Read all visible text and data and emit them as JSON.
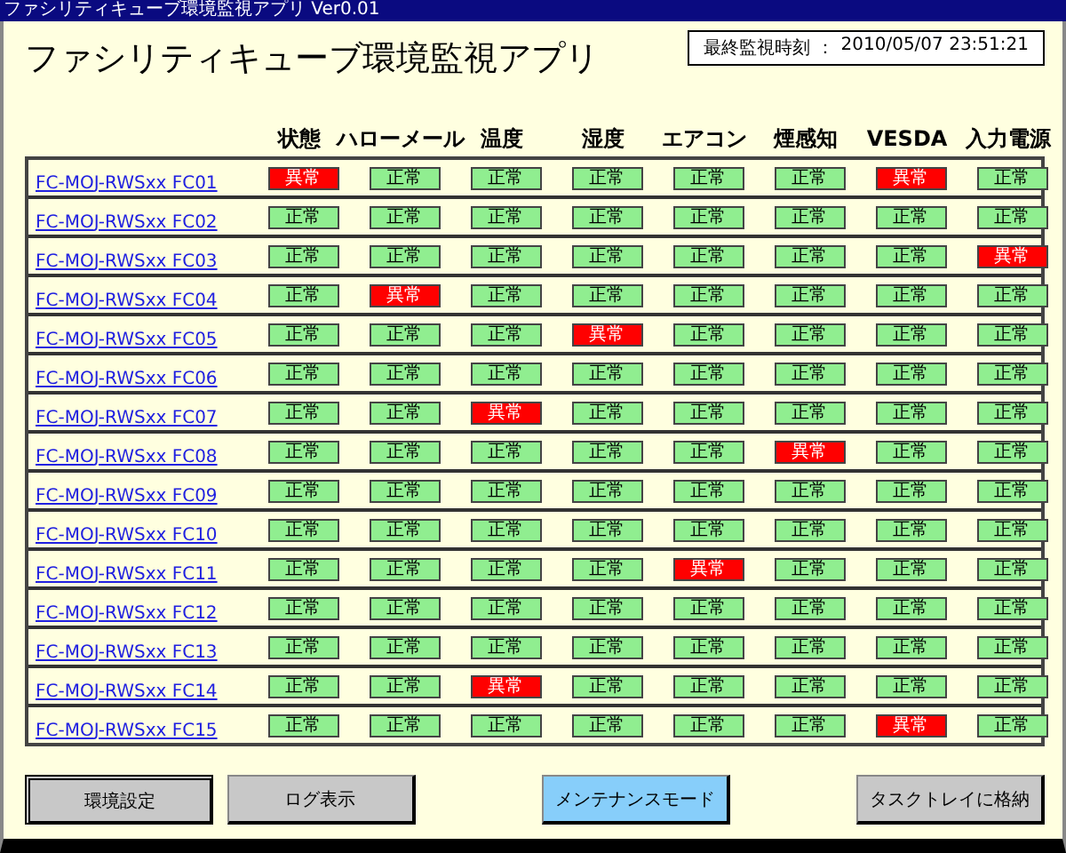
{
  "window": {
    "title": "ファシリティキューブ環境監視アプリ Ver0.01"
  },
  "app_title": "ファシリティキューブ環境監視アプリ",
  "last_check": {
    "label": "最終監視時刻 ：",
    "value": "2010/05/07 23:51:21"
  },
  "columns": [
    "状態",
    "ハローメール",
    "温度",
    "湿度",
    "エアコン",
    "煙感知",
    "VESDA",
    "入力電源"
  ],
  "rows": [
    {
      "name": "FC-MOJ-RWSxx FC01",
      "cells": [
        {
          "text": "異常",
          "alarm": true
        },
        {
          "text": "正常",
          "alarm": false
        },
        {
          "text": "正常",
          "alarm": false
        },
        {
          "text": "正常",
          "alarm": false
        },
        {
          "text": "正常",
          "alarm": false
        },
        {
          "text": "正常",
          "alarm": false
        },
        {
          "text": "異常",
          "alarm": true
        },
        {
          "text": "正常",
          "alarm": false
        }
      ]
    },
    {
      "name": "FC-MOJ-RWSxx FC02",
      "cells": [
        {
          "text": "正常",
          "alarm": false
        },
        {
          "text": "正常",
          "alarm": false
        },
        {
          "text": "正常",
          "alarm": false
        },
        {
          "text": "正常",
          "alarm": false
        },
        {
          "text": "正常",
          "alarm": false
        },
        {
          "text": "正常",
          "alarm": false
        },
        {
          "text": "正常",
          "alarm": false
        },
        {
          "text": "正常",
          "alarm": false
        }
      ]
    },
    {
      "name": "FC-MOJ-RWSxx FC03",
      "cells": [
        {
          "text": "正常",
          "alarm": false
        },
        {
          "text": "正常",
          "alarm": false
        },
        {
          "text": "正常",
          "alarm": false
        },
        {
          "text": "正常",
          "alarm": false
        },
        {
          "text": "正常",
          "alarm": false
        },
        {
          "text": "正常",
          "alarm": false
        },
        {
          "text": "正常",
          "alarm": false
        },
        {
          "text": "異常",
          "alarm": true
        }
      ]
    },
    {
      "name": "FC-MOJ-RWSxx FC04",
      "cells": [
        {
          "text": "正常",
          "alarm": false
        },
        {
          "text": "異常",
          "alarm": true
        },
        {
          "text": "正常",
          "alarm": false
        },
        {
          "text": "正常",
          "alarm": false
        },
        {
          "text": "正常",
          "alarm": false
        },
        {
          "text": "正常",
          "alarm": false
        },
        {
          "text": "正常",
          "alarm": false
        },
        {
          "text": "正常",
          "alarm": false
        }
      ]
    },
    {
      "name": "FC-MOJ-RWSxx FC05",
      "cells": [
        {
          "text": "正常",
          "alarm": false
        },
        {
          "text": "正常",
          "alarm": false
        },
        {
          "text": "正常",
          "alarm": false
        },
        {
          "text": "異常",
          "alarm": true
        },
        {
          "text": "正常",
          "alarm": false
        },
        {
          "text": "正常",
          "alarm": false
        },
        {
          "text": "正常",
          "alarm": false
        },
        {
          "text": "正常",
          "alarm": false
        }
      ]
    },
    {
      "name": "FC-MOJ-RWSxx FC06",
      "cells": [
        {
          "text": "正常",
          "alarm": false
        },
        {
          "text": "正常",
          "alarm": false
        },
        {
          "text": "正常",
          "alarm": false
        },
        {
          "text": "正常",
          "alarm": false
        },
        {
          "text": "正常",
          "alarm": false
        },
        {
          "text": "正常",
          "alarm": false
        },
        {
          "text": "正常",
          "alarm": false
        },
        {
          "text": "正常",
          "alarm": false
        }
      ]
    },
    {
      "name": "FC-MOJ-RWSxx FC07",
      "cells": [
        {
          "text": "正常",
          "alarm": false
        },
        {
          "text": "正常",
          "alarm": false
        },
        {
          "text": "異常",
          "alarm": true
        },
        {
          "text": "正常",
          "alarm": false
        },
        {
          "text": "正常",
          "alarm": false
        },
        {
          "text": "正常",
          "alarm": false
        },
        {
          "text": "正常",
          "alarm": false
        },
        {
          "text": "正常",
          "alarm": false
        }
      ]
    },
    {
      "name": "FC-MOJ-RWSxx FC08",
      "cells": [
        {
          "text": "正常",
          "alarm": false
        },
        {
          "text": "正常",
          "alarm": false
        },
        {
          "text": "正常",
          "alarm": false
        },
        {
          "text": "正常",
          "alarm": false
        },
        {
          "text": "正常",
          "alarm": false
        },
        {
          "text": "異常",
          "alarm": true
        },
        {
          "text": "正常",
          "alarm": false
        },
        {
          "text": "正常",
          "alarm": false
        }
      ]
    },
    {
      "name": "FC-MOJ-RWSxx FC09",
      "cells": [
        {
          "text": "正常",
          "alarm": false
        },
        {
          "text": "正常",
          "alarm": false
        },
        {
          "text": "正常",
          "alarm": false
        },
        {
          "text": "正常",
          "alarm": false
        },
        {
          "text": "正常",
          "alarm": false
        },
        {
          "text": "正常",
          "alarm": false
        },
        {
          "text": "正常",
          "alarm": false
        },
        {
          "text": "正常",
          "alarm": false
        }
      ]
    },
    {
      "name": "FC-MOJ-RWSxx FC10",
      "cells": [
        {
          "text": "正常",
          "alarm": false
        },
        {
          "text": "正常",
          "alarm": false
        },
        {
          "text": "正常",
          "alarm": false
        },
        {
          "text": "正常",
          "alarm": false
        },
        {
          "text": "正常",
          "alarm": false
        },
        {
          "text": "正常",
          "alarm": false
        },
        {
          "text": "正常",
          "alarm": false
        },
        {
          "text": "正常",
          "alarm": false
        }
      ]
    },
    {
      "name": "FC-MOJ-RWSxx FC11",
      "cells": [
        {
          "text": "正常",
          "alarm": false
        },
        {
          "text": "正常",
          "alarm": false
        },
        {
          "text": "正常",
          "alarm": false
        },
        {
          "text": "正常",
          "alarm": false
        },
        {
          "text": "異常",
          "alarm": true
        },
        {
          "text": "正常",
          "alarm": false
        },
        {
          "text": "正常",
          "alarm": false
        },
        {
          "text": "正常",
          "alarm": false
        }
      ]
    },
    {
      "name": "FC-MOJ-RWSxx FC12",
      "cells": [
        {
          "text": "正常",
          "alarm": false
        },
        {
          "text": "正常",
          "alarm": false
        },
        {
          "text": "正常",
          "alarm": false
        },
        {
          "text": "正常",
          "alarm": false
        },
        {
          "text": "正常",
          "alarm": false
        },
        {
          "text": "正常",
          "alarm": false
        },
        {
          "text": "正常",
          "alarm": false
        },
        {
          "text": "正常",
          "alarm": false
        }
      ]
    },
    {
      "name": "FC-MOJ-RWSxx FC13",
      "cells": [
        {
          "text": "正常",
          "alarm": false
        },
        {
          "text": "正常",
          "alarm": false
        },
        {
          "text": "正常",
          "alarm": false
        },
        {
          "text": "正常",
          "alarm": false
        },
        {
          "text": "正常",
          "alarm": false
        },
        {
          "text": "正常",
          "alarm": false
        },
        {
          "text": "正常",
          "alarm": false
        },
        {
          "text": "正常",
          "alarm": false
        }
      ]
    },
    {
      "name": "FC-MOJ-RWSxx FC14",
      "cells": [
        {
          "text": "正常",
          "alarm": false
        },
        {
          "text": "正常",
          "alarm": false
        },
        {
          "text": "異常",
          "alarm": true
        },
        {
          "text": "正常",
          "alarm": false
        },
        {
          "text": "正常",
          "alarm": false
        },
        {
          "text": "正常",
          "alarm": false
        },
        {
          "text": "正常",
          "alarm": false
        },
        {
          "text": "正常",
          "alarm": false
        }
      ]
    },
    {
      "name": "FC-MOJ-RWSxx FC15",
      "cells": [
        {
          "text": "正常",
          "alarm": false
        },
        {
          "text": "正常",
          "alarm": false
        },
        {
          "text": "正常",
          "alarm": false
        },
        {
          "text": "正常",
          "alarm": false
        },
        {
          "text": "正常",
          "alarm": false
        },
        {
          "text": "正常",
          "alarm": false
        },
        {
          "text": "異常",
          "alarm": true
        },
        {
          "text": "正常",
          "alarm": false
        }
      ]
    }
  ],
  "buttons": [
    {
      "label": "環境設定",
      "kind": "default"
    },
    {
      "label": "ログ表示",
      "kind": "normal"
    },
    {
      "label": "メンテナンスモード",
      "kind": "accent"
    },
    {
      "label": "タスクトレイに格納",
      "kind": "normal"
    }
  ]
}
